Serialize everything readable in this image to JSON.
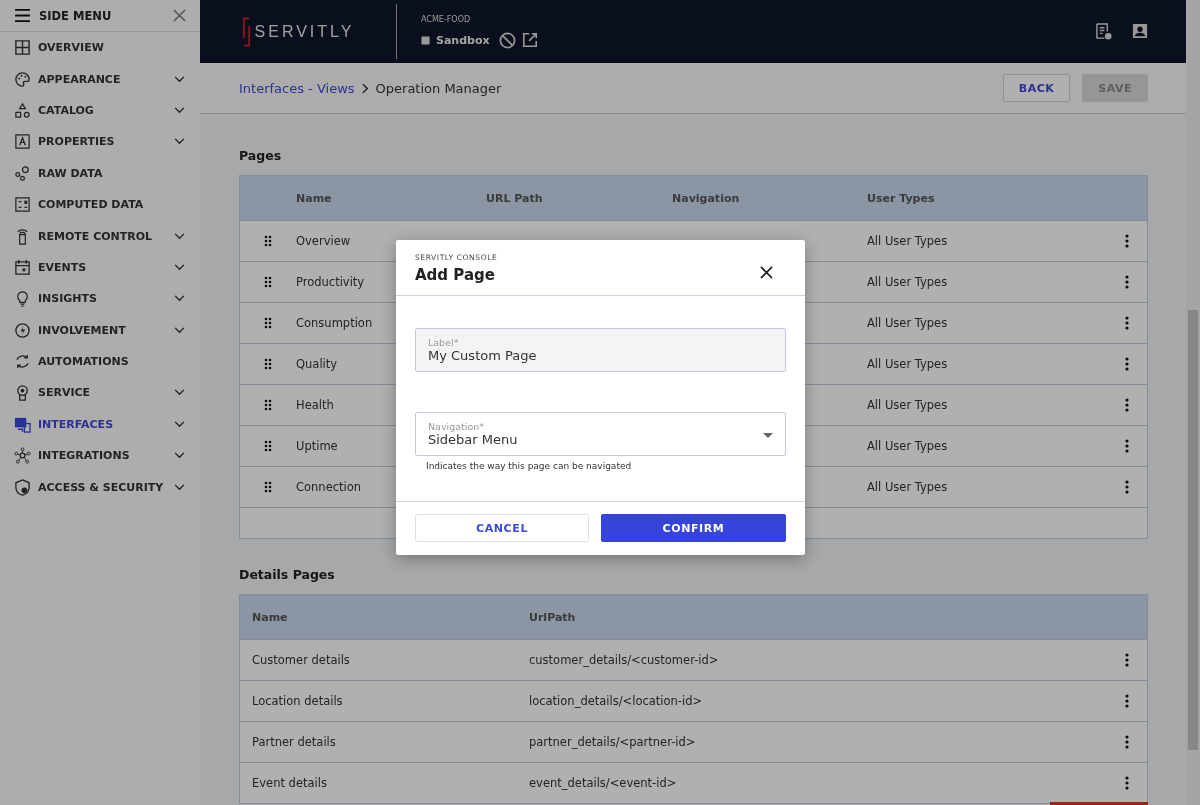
{
  "sidebar": {
    "title": "SIDE MENU",
    "items": [
      {
        "label": "OVERVIEW",
        "selected": false,
        "expandable": false
      },
      {
        "label": "APPEARANCE",
        "selected": false,
        "expandable": true
      },
      {
        "label": "CATALOG",
        "selected": false,
        "expandable": true
      },
      {
        "label": "PROPERTIES",
        "selected": false,
        "expandable": true
      },
      {
        "label": "RAW DATA",
        "selected": false,
        "expandable": false
      },
      {
        "label": "COMPUTED DATA",
        "selected": false,
        "expandable": false
      },
      {
        "label": "REMOTE CONTROL",
        "selected": false,
        "expandable": true
      },
      {
        "label": "EVENTS",
        "selected": false,
        "expandable": true
      },
      {
        "label": "INSIGHTS",
        "selected": false,
        "expandable": true
      },
      {
        "label": "INVOLVEMENT",
        "selected": false,
        "expandable": true
      },
      {
        "label": "AUTOMATIONS",
        "selected": false,
        "expandable": false
      },
      {
        "label": "SERVICE",
        "selected": false,
        "expandable": true
      },
      {
        "label": "INTERFACES",
        "selected": true,
        "expandable": true
      },
      {
        "label": "INTEGRATIONS",
        "selected": false,
        "expandable": true
      },
      {
        "label": "ACCESS & SECURITY",
        "selected": false,
        "expandable": true
      }
    ]
  },
  "header": {
    "logo": "SERVITLY",
    "tenant": "ACME-FOOD",
    "environment": "Sandbox"
  },
  "breadcrumb": {
    "link": "Interfaces - Views",
    "current": "Operation Manager"
  },
  "actions": [
    {
      "label": "BACK",
      "disabled": false
    },
    {
      "label": "SAVE",
      "disabled": true
    }
  ],
  "pages": {
    "title": "Pages",
    "columns": [
      "Name",
      "URL Path",
      "Navigation",
      "User Types"
    ],
    "rows": [
      {
        "name": "Overview",
        "user_types": "All User Types"
      },
      {
        "name": "Productivity",
        "user_types": "All User Types"
      },
      {
        "name": "Consumption",
        "user_types": "All User Types"
      },
      {
        "name": "Quality",
        "user_types": "All User Types"
      },
      {
        "name": "Health",
        "user_types": "All User Types"
      },
      {
        "name": "Uptime",
        "user_types": "All User Types"
      },
      {
        "name": "Connection",
        "user_types": "All User Types"
      }
    ]
  },
  "details_pages": {
    "title": "Details Pages",
    "columns": [
      "Name",
      "UrlPath"
    ],
    "rows": [
      {
        "name": "Customer details",
        "url_path": "customer_details/<customer-id>"
      },
      {
        "name": "Location details",
        "url_path": "location_details/<location-id>"
      },
      {
        "name": "Partner details",
        "url_path": "partner_details/<partner-id>"
      },
      {
        "name": "Event details",
        "url_path": "event_details/<event-id>"
      }
    ]
  },
  "dialog": {
    "caption": "SERVITLY CONSOLE",
    "title": "Add Page",
    "label_field": {
      "label": "Label*",
      "value": "My Custom Page"
    },
    "navigation_field": {
      "label": "Navigation*",
      "value": "Sidebar Menu",
      "hint": "Indicates the way this page can be navigated"
    },
    "buttons": [
      {
        "label": "CANCEL",
        "kind": "secondary"
      },
      {
        "label": "CONFIRM",
        "kind": "primary"
      }
    ]
  }
}
